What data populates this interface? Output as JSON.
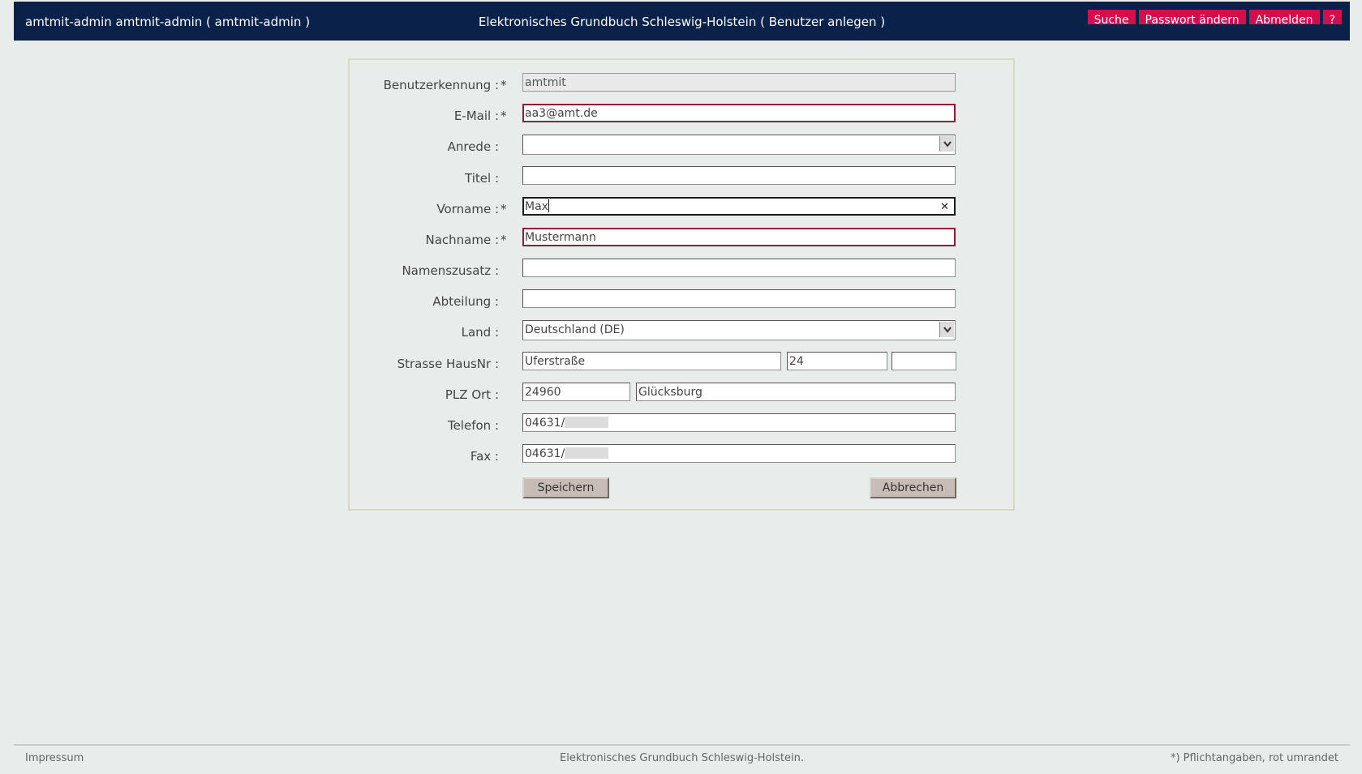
{
  "header": {
    "user": "amtmit-admin amtmit-admin  ( amtmit-admin )",
    "title": "Elektronisches Grundbuch Schleswig-Holstein  ( Benutzer anlegen )",
    "buttons": {
      "search": "Suche",
      "change_password": "Passwort ändern",
      "logout": "Abmelden",
      "help": "?"
    }
  },
  "form": {
    "required_marker": "*",
    "fields": {
      "benutzerkennung": {
        "label": "Benutzerkennung :",
        "value": "amtmit"
      },
      "email": {
        "label": "E-Mail :",
        "value": "aa3@amt.de"
      },
      "anrede": {
        "label": "Anrede :",
        "value": ""
      },
      "titel": {
        "label": "Titel :",
        "value": ""
      },
      "vorname": {
        "label": "Vorname :",
        "value": "Max"
      },
      "nachname": {
        "label": "Nachname :",
        "value": "Mustermann"
      },
      "namenszusatz": {
        "label": "Namenszusatz :",
        "value": ""
      },
      "abteilung": {
        "label": "Abteilung :",
        "value": ""
      },
      "land": {
        "label": "Land :",
        "value": "Deutschland (DE)"
      },
      "strasse": {
        "label": "Strasse HausNr :",
        "street": "Uferstraße",
        "number": "24",
        "suffix": ""
      },
      "plz_ort": {
        "label": "PLZ Ort :",
        "plz": "24960",
        "ort": "Glücksburg"
      },
      "telefon": {
        "label": "Telefon :",
        "value": "04631/"
      },
      "fax": {
        "label": "Fax :",
        "value": "04631/"
      }
    },
    "buttons": {
      "save": "Speichern",
      "cancel": "Abbrechen"
    }
  },
  "footer": {
    "impressum": "Impressum",
    "center": "Elektronisches Grundbuch Schleswig-Holstein.",
    "note": "*) Pflichtangaben, rot umrandet"
  },
  "colors": {
    "header_bg": "#0a2249",
    "accent_button": "#d20f4b",
    "required_border": "#8e1a3c",
    "page_bg": "#e8ecea"
  }
}
